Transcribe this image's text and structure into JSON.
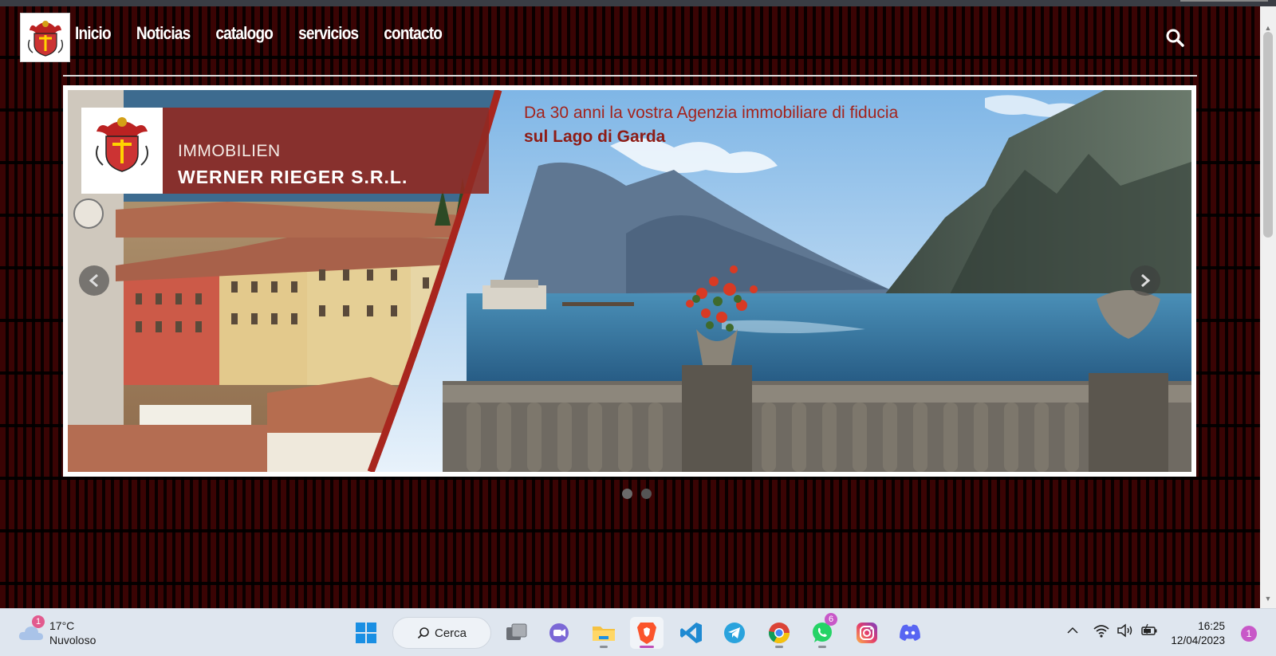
{
  "nav": {
    "items": [
      "Inicio",
      "Noticias",
      "catalogo",
      "servicios",
      "contacto"
    ]
  },
  "logo": {
    "icon": "coat-of-arms-logo"
  },
  "search": {
    "icon": "search-icon"
  },
  "slider": {
    "headline_line1": "Da 30 anni la vostra Agenzia immobiliare di fiducia",
    "headline_line2": "sul Lago di Garda",
    "brand_line1": "IMMOBILIEN",
    "brand_line2": "WERNER RIEGER S.R.L.",
    "slide_count": 2,
    "active_slide": 1
  },
  "taskbar": {
    "weather": {
      "temp": "17°C",
      "condition": "Nuvoloso",
      "badge": "1"
    },
    "search_label": "Cerca",
    "apps": [
      {
        "name": "windows-start-icon",
        "active": false,
        "running": false
      },
      {
        "name": "task-view-icon",
        "active": false,
        "running": false
      },
      {
        "name": "teams-chat-icon",
        "active": false,
        "running": false
      },
      {
        "name": "file-explorer-icon",
        "active": false,
        "running": true
      },
      {
        "name": "brave-browser-icon",
        "active": true,
        "running": true
      },
      {
        "name": "vscode-icon",
        "active": false,
        "running": false
      },
      {
        "name": "telegram-icon",
        "active": false,
        "running": false
      },
      {
        "name": "chrome-icon",
        "active": false,
        "running": true
      },
      {
        "name": "whatsapp-icon",
        "active": false,
        "running": true,
        "badge": "6"
      },
      {
        "name": "instagram-icon",
        "active": false,
        "running": false
      },
      {
        "name": "discord-icon",
        "active": false,
        "running": false
      }
    ],
    "clock": {
      "time": "16:25",
      "date": "12/04/2023"
    },
    "notification_badge": "1"
  },
  "colors": {
    "page_bg": "#0a0000",
    "pattern": "#3a0404",
    "brand_red": "#9b2a22",
    "headline_red": "#a3231c",
    "taskbar": "#dfe6ef"
  }
}
